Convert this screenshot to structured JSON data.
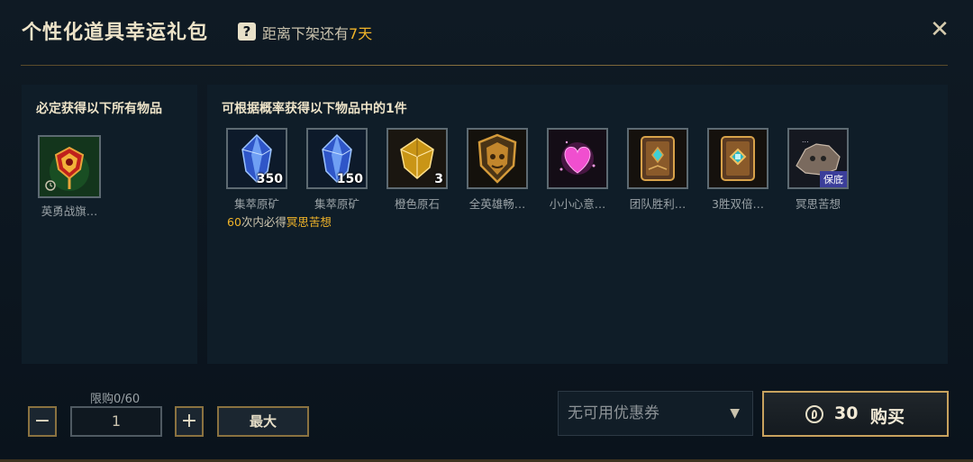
{
  "header": {
    "title": "个性化道具幸运礼包",
    "help": "?",
    "delist_prefix": "距离下架还有",
    "delist_days": "7天",
    "close": "✕"
  },
  "guaranteed": {
    "title": "必定获得以下所有物品",
    "items": [
      {
        "caption": "英勇战旗…",
        "icon": "banner-icon"
      }
    ]
  },
  "random": {
    "title": "可根据概率获得以下物品中的1件",
    "items": [
      {
        "caption": "集萃原矿",
        "qty": "350",
        "icon": "blue-crystal-icon"
      },
      {
        "caption": "集萃原矿",
        "qty": "150",
        "icon": "blue-crystal-icon"
      },
      {
        "caption": "橙色原石",
        "qty": "3",
        "icon": "orange-essence-icon"
      },
      {
        "caption": "全英雄畅…",
        "qty": "",
        "icon": "champion-shield-icon"
      },
      {
        "caption": "小小心意…",
        "qty": "",
        "icon": "heart-icon"
      },
      {
        "caption": "团队胜利…",
        "qty": "",
        "icon": "card-icon"
      },
      {
        "caption": "3胜双倍…",
        "qty": "",
        "icon": "card-icon"
      },
      {
        "caption": "冥思苦想",
        "badge": "保底",
        "icon": "emote-icon"
      }
    ],
    "note_count": "60",
    "note_mid": "次内必得",
    "note_item": "冥思苦想"
  },
  "purchase": {
    "limit": "限购0/60",
    "minus": "−",
    "quantity": "1",
    "plus": "+",
    "max": "最大",
    "coupon": "无可用优惠券",
    "price": "30",
    "buy": "购买"
  }
}
